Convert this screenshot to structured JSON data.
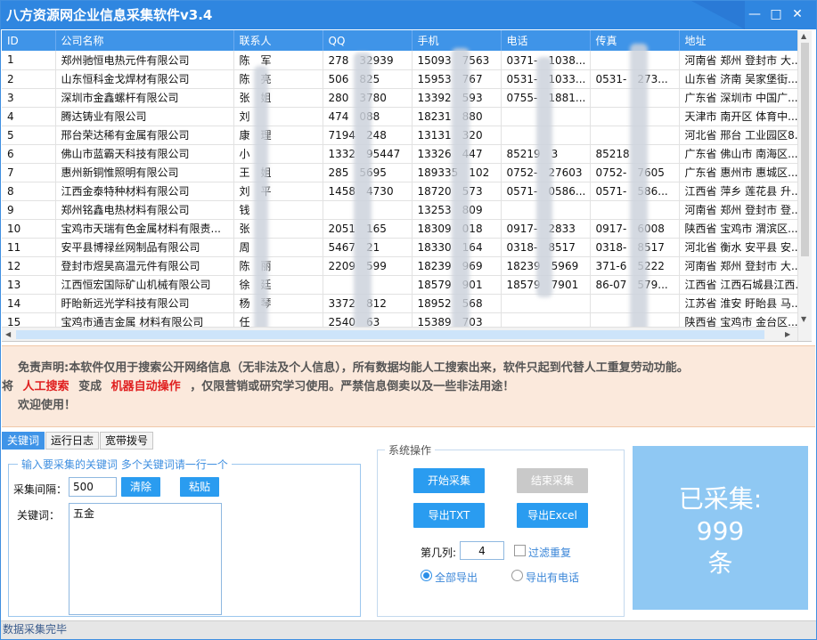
{
  "window": {
    "title": "八方资源网企业信息采集软件v3.4"
  },
  "grid": {
    "columns": [
      "ID",
      "公司名称",
      "联系人",
      "QQ",
      "手机",
      "电话",
      "传真",
      "地址"
    ],
    "rows": [
      [
        "1",
        "郑州驰恒电热元件有限公司",
        "陈　军",
        "278　32939",
        "15093　7563",
        "0371-　1038...",
        "",
        "河南省 郑州 登封市 大..."
      ],
      [
        "2",
        "山东恒科金戈焊材有限公司",
        "陈　亮",
        "506　825",
        "15953　767",
        "0531-　1033...",
        "0531-　273...",
        "山东省 济南 吴家堡街..."
      ],
      [
        "3",
        "深圳市金鑫螺杆有限公司",
        "张　姐",
        "280　3780",
        "13392　593",
        "0755-　1881...",
        "",
        "广东省 深圳市 中国广..."
      ],
      [
        "4",
        "腾达铸业有限公司",
        "刘　",
        "474　088",
        "18231　880",
        "",
        "",
        "天津市 南开区 体育中..."
      ],
      [
        "5",
        "邢台荣达稀有金属有限公司",
        "康　理",
        "7194　248",
        "13131　320",
        "",
        "",
        "河北省 邢台 工业园区8..."
      ],
      [
        "6",
        "佛山市蓝霸天科技有限公司",
        "小　",
        "1332　95447",
        "13326　447",
        "85219　3",
        "85218　",
        "广东省 佛山市 南海区..."
      ],
      [
        "7",
        "惠州新铜惟照明有限公司",
        "王　姐",
        "285　5695",
        "189335　102",
        "0752-　27603",
        "0752-　7605",
        "广东省 惠州市 惠城区..."
      ],
      [
        "8",
        "江西金泰特种材料有限公司",
        "刘　平",
        "1458　4730",
        "18720　573",
        "0571-　0586...",
        "0571-　586...",
        "江西省 萍乡 莲花县 升..."
      ],
      [
        "9",
        "郑州铭鑫电热材料有限公司",
        "钱　",
        "",
        "13253　809",
        "",
        "",
        "河南省 郑州 登封市 登..."
      ],
      [
        "10",
        "宝鸡市天瑞有色金属材料有限责...",
        "张　",
        "2051　165",
        "18309　018",
        "0917-　2833",
        "0917-　6008",
        "陕西省 宝鸡市 渭滨区..."
      ],
      [
        "11",
        "安平县博禄丝网制品有限公司",
        "周　",
        "5467　21",
        "18330　164",
        "0318-　8517",
        "0318-　8517",
        "河北省 衡水 安平县 安..."
      ],
      [
        "12",
        "登封市煜昊高温元件有限公司",
        "陈　丽",
        "2209　599",
        "18239　969",
        "18239　5969",
        "371-6　5222",
        "河南省 郑州 登封市 大..."
      ],
      [
        "13",
        "江西恒宏国际矿山机械有限公司",
        "徐　廷",
        "",
        "18579　901",
        "18579　7901",
        "86-07　579...",
        "江西省 江西石城县江西..."
      ],
      [
        "14",
        "盱眙新远光学科技有限公司",
        "杨　琴",
        "3372　812",
        "18952　568",
        "",
        "",
        "江苏省 淮安 盱眙县 马..."
      ],
      [
        "15",
        "宝鸡市通吉金属 材料有限公司",
        "任　",
        "2540　63",
        "15389　703",
        "",
        "",
        "陕西省 宝鸡市 金台区..."
      ]
    ]
  },
  "disclaimer": {
    "line1": "免责声明:本软件仅用于搜索公开网络信息（无非法及个人信息），所有数据均能人工搜索出来，软件只起到代替人工重复劳动功能。",
    "line2_prefix": "将",
    "line2_red1": "人工搜索",
    "line2_mid": "变成",
    "line2_red2": "机器自动操作",
    "line2_suffix": "，仅限营销或研究学习使用。严禁信息倒卖以及一些非法用途！",
    "line3": "欢迎使用！"
  },
  "tabs": [
    "关键词",
    "运行日志",
    "宽带拨号"
  ],
  "keywords_panel": {
    "legend": "输入要采集的关键词 多个关键词请一行一个",
    "interval_label": "采集间隔：",
    "interval_value": "500",
    "clear_label": "清除",
    "paste_label": "粘贴",
    "keyword_label": "关键词：",
    "keyword_value": "五金"
  },
  "ops_panel": {
    "legend": "系统操作",
    "start_label": "开始采集",
    "stop_label": "结束采集",
    "export_txt_label": "导出TXT",
    "export_excel_label": "导出Excel",
    "column_label": "第几列:",
    "column_value": "4",
    "filter_dup_label": "过滤重复",
    "export_all_label": "全部导出",
    "export_phone_label": "导出有电话"
  },
  "counter": {
    "line1": "已采集:",
    "count": "999",
    "unit": "条"
  },
  "status": {
    "text": "数据采集完毕"
  },
  "colors": {
    "accent": "#2f86e0",
    "header": "#3f94e8",
    "button": "#2a9cf0",
    "counter_bg": "#8fc8f3",
    "disclaimer_bg": "#fbe9dc",
    "red": "#e02020"
  }
}
